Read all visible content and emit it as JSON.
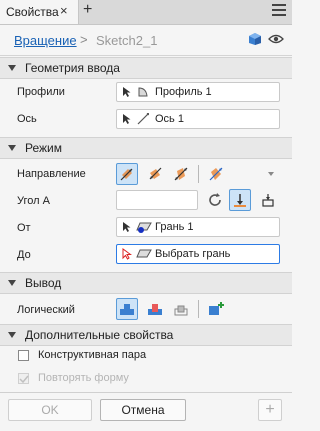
{
  "tab": {
    "title": "Свойства",
    "close_glyph": "×",
    "add_glyph": "+"
  },
  "breadcrumb": {
    "feature": "Вращение",
    "separator": ">",
    "sketch": "Sketch2_1"
  },
  "sections": {
    "input": {
      "title": "Геометрия ввода",
      "profiles": {
        "label": "Профили",
        "value": "Профиль 1"
      },
      "axis": {
        "label": "Ось",
        "value": "Ось 1"
      }
    },
    "mode": {
      "title": "Режим",
      "direction_label": "Направление",
      "angle": {
        "label": "Угол А",
        "value": ""
      },
      "from": {
        "label": "От",
        "value": "Грань 1"
      },
      "to": {
        "label": "До",
        "value": "Выбрать грань"
      }
    },
    "output": {
      "title": "Вывод",
      "boolean_label": "Логический"
    },
    "advanced": {
      "title": "Дополнительные свойства",
      "construction_pair": "Конструктивная пара",
      "repeat_form": "Повторять форму"
    }
  },
  "footer": {
    "ok": "OK",
    "cancel": "Отмена",
    "add_glyph": "+"
  },
  "colors": {
    "accent": "#1a62b5",
    "active_bg": "#cde3f7",
    "focus_border": "#2c7be5",
    "shape_orange": "#e98a3c"
  }
}
